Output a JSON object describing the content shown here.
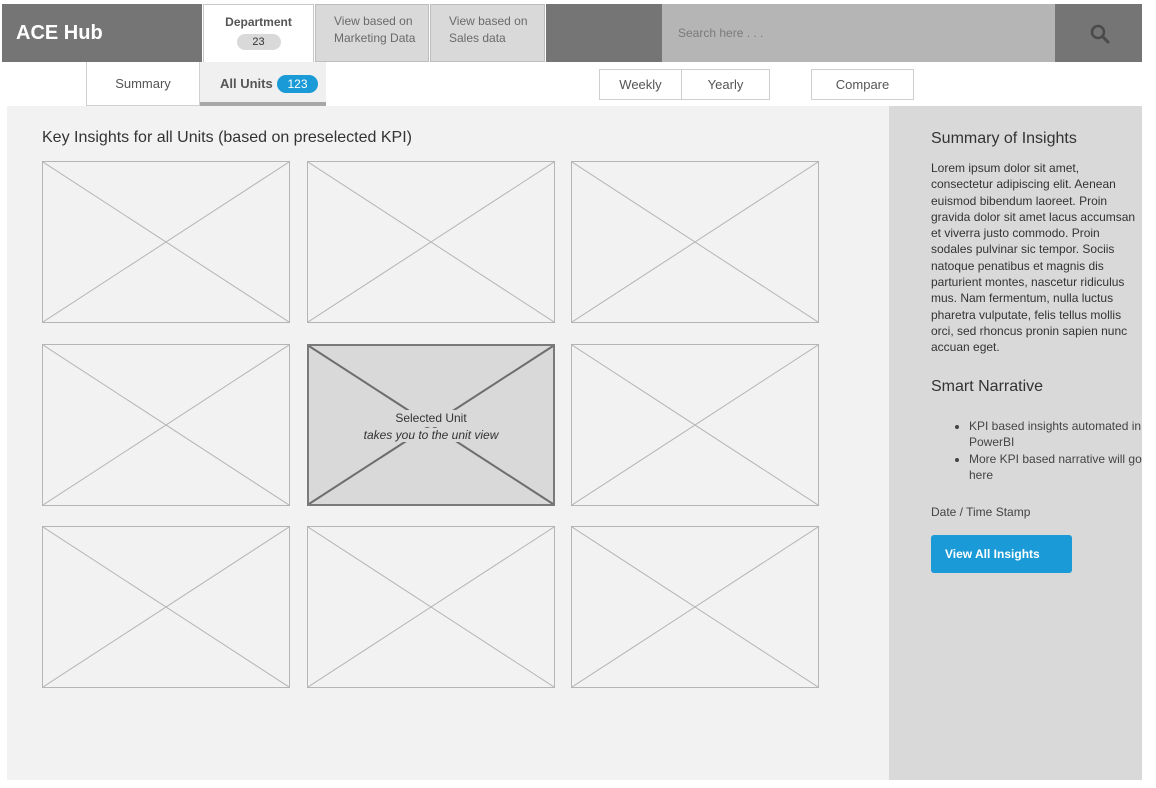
{
  "header": {
    "brand": "ACE Hub",
    "tabs": [
      {
        "label": "Department",
        "count": "23"
      },
      {
        "label_line1": "View based on",
        "label_line2": "Marketing Data"
      },
      {
        "label_line1": "View based on",
        "label_line2": "Sales data"
      }
    ],
    "search": {
      "placeholder": "Search here . . ."
    },
    "search_icon": "search-icon"
  },
  "subnav": {
    "tabs": [
      {
        "label": "Summary"
      },
      {
        "label": "All Units",
        "count": "123"
      }
    ],
    "period": [
      "Weekly",
      "Yearly"
    ],
    "compare": "Compare"
  },
  "main": {
    "title": "Key Insights for all Units (based on preselected KPI)",
    "selected_tile": {
      "title": "Selected Unit",
      "subtitle": "takes you to the unit view"
    }
  },
  "panel": {
    "summary_title": "Summary of Insights",
    "summary_body": "Lorem ipsum dolor sit amet, consectetur adipiscing elit. Aenean euismod bibendum laoreet. Proin gravida dolor sit amet lacus accumsan et viverra justo commodo. Proin sodales pulvinar sic tempor. Sociis natoque penatibus et magnis dis parturient montes, nascetur ridiculus mus. Nam fermentum, nulla luctus pharetra vulputate, felis tellus mollis orci, sed rhoncus pronin sapien nunc accuan eget.",
    "narrative_title": "Smart Narrative",
    "narrative_items": [
      "KPI based insights automated in PowerBI",
      "More KPI based narrative will go here"
    ],
    "timestamp": "Date / Time Stamp",
    "button": "View All Insights"
  },
  "colors": {
    "accent": "#1a9ad6",
    "header_dark": "#757575"
  }
}
